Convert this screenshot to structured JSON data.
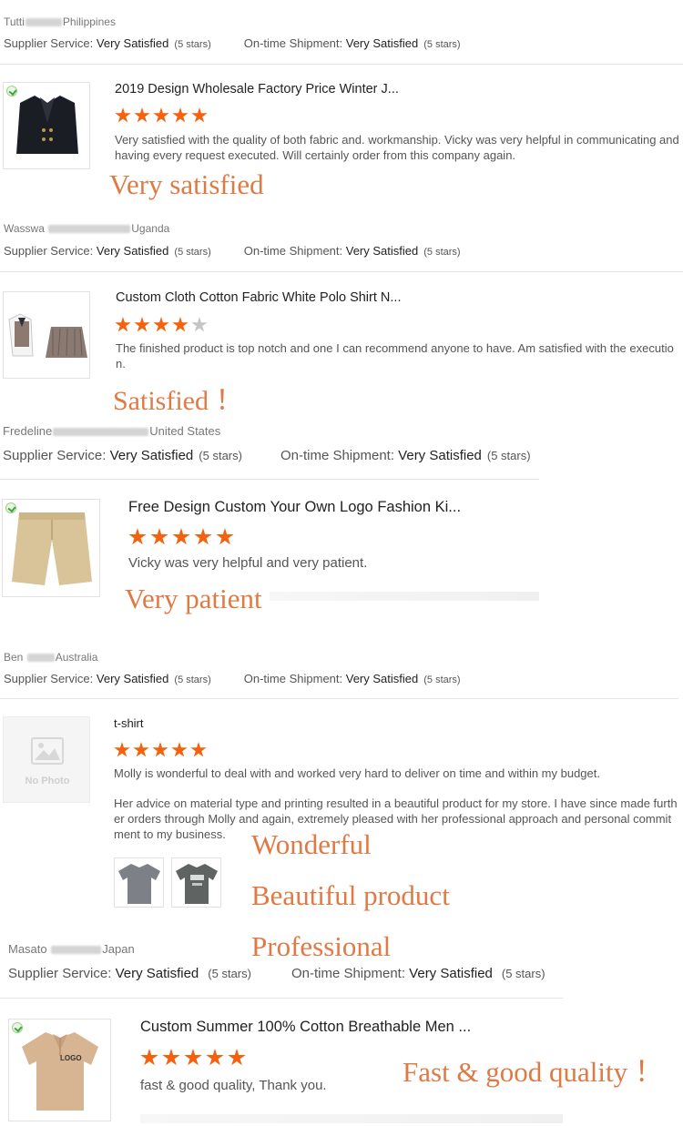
{
  "labels": {
    "supplier_service": "Supplier Service:",
    "ontime_shipment": "On-time Shipment:",
    "no_photo": "No Photo"
  },
  "annotation_color": "#e07a45",
  "star_color": "#f4620f",
  "reviews": [
    {
      "reviewer_first": "Tutti",
      "reviewer_country": "Philippines",
      "supplier_rating": "Very Satisfied",
      "supplier_stars": "(5 stars)",
      "shipment_rating": "Very Satisfied",
      "shipment_stars": "(5 stars)",
      "product_title": "2019 Design Wholesale Factory Price Winter J...",
      "stars": 5,
      "text": "Very satisfied with the quality of both fabric and. workmanship. Vicky was very helpful in communicating and having every request executed.  Will certainly order from this company again.",
      "annotation": "Very satisfied",
      "thumb_icon": "blazer-icon"
    },
    {
      "reviewer_first": "Wasswa",
      "reviewer_country": "Uganda",
      "supplier_rating": "Very Satisfied",
      "supplier_stars": "(5 stars)",
      "shipment_rating": "Very Satisfied",
      "shipment_stars": "(5 stars)",
      "product_title": "Custom Cloth Cotton Fabric White Polo Shirt N...",
      "stars": 4,
      "text": "The finished product is top notch and one I can recommend anyone to have. Am satisfied with the execution.",
      "annotation": "Satisfied ！",
      "thumb_icon": "uniform-set-icon"
    },
    {
      "reviewer_first": "Fredeline",
      "reviewer_country": "United States",
      "supplier_rating": "Very Satisfied",
      "supplier_stars": "(5 stars)",
      "shipment_rating": "Very Satisfied",
      "shipment_stars": "(5 stars)",
      "product_title": "Free Design Custom Your Own Logo Fashion Ki...",
      "stars": 5,
      "text": "Vicky was very helpful and very patient.",
      "annotation": "Very patient",
      "thumb_icon": "shorts-icon"
    },
    {
      "reviewer_first": "Ben",
      "reviewer_country": "Australia",
      "supplier_rating": "Very Satisfied",
      "supplier_stars": "(5 stars)",
      "shipment_rating": "Very Satisfied",
      "shipment_stars": "(5 stars)",
      "product_title": "t-shirt",
      "stars": 5,
      "text": "Molly is wonderful to deal with and worked very hard to deliver on time and within my budget.",
      "text2": "Her advice on material type and printing resulted in a beautiful product for my store.  I have since made further orders through Molly and again, extremely pleased with her professional approach and personal commitment to my business.",
      "annotations": [
        "Wonderful",
        "Beautiful product",
        "Professional"
      ],
      "thumb_icon": "no-photo-icon"
    },
    {
      "reviewer_first": "Masato",
      "reviewer_country": "Japan",
      "supplier_rating": "Very Satisfied",
      "supplier_stars": "(5 stars)",
      "shipment_rating": "Very Satisfied",
      "shipment_stars": "(5 stars)",
      "product_title": "Custom Summer 100% Cotton Breathable Men ...",
      "stars": 5,
      "text": "fast & good quality, Thank you.",
      "annotation": "Fast & good quality ！",
      "thumb_icon": "polo-shirt-icon",
      "logo_text": "LOGO"
    }
  ]
}
